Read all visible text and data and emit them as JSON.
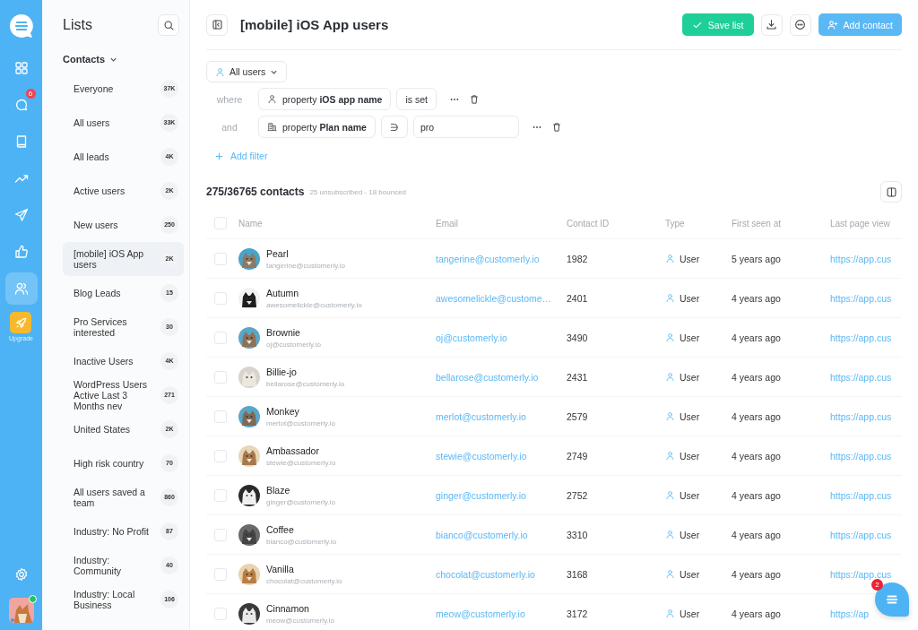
{
  "rail": {
    "items": [
      {
        "kind": "grid",
        "selected": false
      },
      {
        "kind": "chat",
        "selected": false,
        "badge": "6"
      },
      {
        "kind": "book",
        "selected": false
      },
      {
        "kind": "trend",
        "selected": false
      },
      {
        "kind": "send",
        "selected": false
      },
      {
        "kind": "thumb",
        "selected": false
      },
      {
        "kind": "users",
        "selected": true
      }
    ],
    "upgrade": {
      "label": "Upgrade"
    },
    "user": {
      "online": true
    }
  },
  "lists": {
    "title": "Lists",
    "section": "Contacts",
    "items": [
      {
        "label": "Everyone",
        "count": "37K",
        "selected": false
      },
      {
        "label": "All users",
        "count": "33K",
        "selected": false
      },
      {
        "label": "All leads",
        "count": "4K",
        "selected": false
      },
      {
        "label": "Active users",
        "count": "2K",
        "selected": false
      },
      {
        "label": "New users",
        "count": "250",
        "selected": false
      },
      {
        "label": "[mobile] iOS App users",
        "count": "2K",
        "selected": true
      },
      {
        "label": "Blog Leads",
        "count": "15",
        "selected": false
      },
      {
        "label": "Pro Services interested",
        "count": "30",
        "selected": false
      },
      {
        "label": "Inactive Users",
        "count": "4K",
        "selected": false
      },
      {
        "label": "WordPress Users Active Last 3 Months nev",
        "count": "271",
        "selected": false
      },
      {
        "label": "United States",
        "count": "2K",
        "selected": false
      },
      {
        "label": "High risk country",
        "count": "70",
        "selected": false
      },
      {
        "label": "All users saved a team",
        "count": "860",
        "selected": false
      },
      {
        "label": "Industry: No Profit",
        "count": "87",
        "selected": false
      },
      {
        "label": "Industry: Community",
        "count": "40",
        "selected": false
      },
      {
        "label": "Industry: Local Business",
        "count": "106",
        "selected": false
      }
    ]
  },
  "header": {
    "title": "[mobile] iOS App users",
    "save": "Save list",
    "add": "Add contact"
  },
  "filters": {
    "audience": "All users",
    "rows": [
      {
        "connector": "where",
        "kind": "person",
        "property": "property **iOS app name**",
        "operator": "is set"
      },
      {
        "connector": "and",
        "kind": "company",
        "property": "property **Plan name**",
        "operator": "∋",
        "value": "pro"
      }
    ],
    "add": "Add filter"
  },
  "summary": {
    "count": "275/36765 contacts",
    "detail": "25 unsubscribed - 18 bounced"
  },
  "table": {
    "select_all_checked": false,
    "columns": [
      "Name",
      "Email",
      "Contact ID",
      "Type",
      "First seen at",
      "Last page view"
    ],
    "rows": [
      {
        "checked": false,
        "name": "Pearl",
        "sub": "tangerine@customerly.io",
        "email": "tangerine@customerly.io",
        "id": "1982",
        "type": "User",
        "seen": "5 years ago",
        "page": "https://app.cus"
      },
      {
        "checked": false,
        "name": "Autumn",
        "sub": "awesomelickle@customerly.io",
        "email": "awesomelickle@custome…",
        "id": "2401",
        "type": "User",
        "seen": "4 years ago",
        "page": "https://app.cus"
      },
      {
        "checked": false,
        "name": "Brownie",
        "sub": "oj@customerly.io",
        "email": "oj@customerly.io",
        "id": "3490",
        "type": "User",
        "seen": "4 years ago",
        "page": "https://app.cus"
      },
      {
        "checked": false,
        "name": "Billie-jo",
        "sub": "bellarose@customerly.io",
        "email": "bellarose@customerly.io",
        "id": "2431",
        "type": "User",
        "seen": "4 years ago",
        "page": "https://app.cus"
      },
      {
        "checked": false,
        "name": "Monkey",
        "sub": "merlot@customerly.io",
        "email": "merlot@customerly.io",
        "id": "2579",
        "type": "User",
        "seen": "4 years ago",
        "page": "https://app.cus"
      },
      {
        "checked": false,
        "name": "Ambassador",
        "sub": "stewie@customerly.io",
        "email": "stewie@customerly.io",
        "id": "2749",
        "type": "User",
        "seen": "4 years ago",
        "page": "https://app.cus"
      },
      {
        "checked": false,
        "name": "Blaze",
        "sub": "ginger@customerly.io",
        "email": "ginger@customerly.io",
        "id": "2752",
        "type": "User",
        "seen": "4 years ago",
        "page": "https://app.cus"
      },
      {
        "checked": false,
        "name": "Coffee",
        "sub": "bianco@customerly.io",
        "email": "bianco@customerly.io",
        "id": "3310",
        "type": "User",
        "seen": "4 years ago",
        "page": "https://app.cus"
      },
      {
        "checked": false,
        "name": "Vanilla",
        "sub": "chocolat@customerly.io",
        "email": "chocolat@customerly.io",
        "id": "3168",
        "type": "User",
        "seen": "4 years ago",
        "page": "https://app.cus"
      },
      {
        "checked": false,
        "name": "Cinnamon",
        "sub": "meow@customerly.io",
        "email": "meow@customerly.io",
        "id": "3172",
        "type": "User",
        "seen": "4 years ago",
        "page": "https://ap"
      }
    ]
  },
  "chat": {
    "badge": "2"
  }
}
